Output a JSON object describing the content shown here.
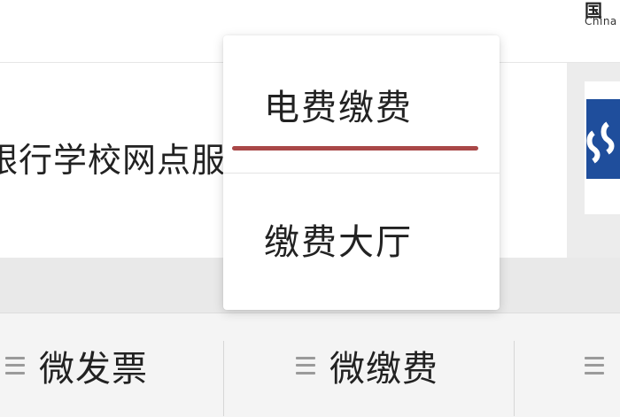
{
  "corner_logo": {
    "sub": "China"
  },
  "info": {
    "service_text": "银行学校网点服"
  },
  "popup": {
    "items": [
      {
        "label": "电费缴费"
      },
      {
        "label": "缴费大厅"
      }
    ],
    "underline_color": "#a94747"
  },
  "bottom_menu": {
    "items": [
      {
        "label": "微发票",
        "icon": "menu-lines-icon"
      },
      {
        "label": "微缴费",
        "icon": "menu-lines-icon"
      },
      {
        "label": "",
        "icon": "menu-lines-icon"
      }
    ]
  }
}
